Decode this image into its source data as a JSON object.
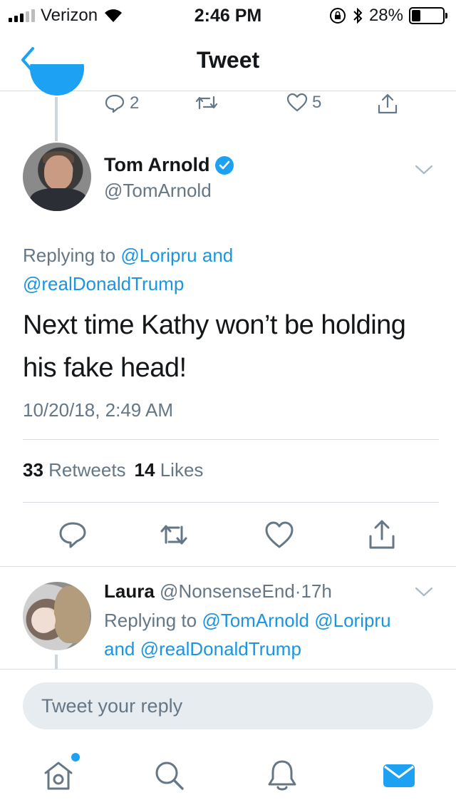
{
  "status_bar": {
    "carrier": "Verizon",
    "time": "2:46 PM",
    "battery": "28%",
    "battery_level": 0.28
  },
  "nav": {
    "title": "Tweet"
  },
  "prev_tweet": {
    "reply_count": "2",
    "like_count": "5"
  },
  "tweet": {
    "author_name": "Tom Arnold",
    "author_handle": "@TomArnold",
    "replying_prefix": "Replying to",
    "replying_user1": "@Loripru",
    "replying_and": "and",
    "replying_user2": "@realDonaldTrump",
    "text": "Next time Kathy won’t be holding his fake head!",
    "timestamp": "10/20/18, 2:49 AM",
    "retweets_count": "33",
    "retweets_label": "Retweets",
    "likes_count": "14",
    "likes_label": "Likes"
  },
  "reply": {
    "name": "Laura",
    "handle": "@NonsenseEnd",
    "dot": "·",
    "time": "17h",
    "replying_prefix": "Replying to",
    "user1": "@TomArnold",
    "user2": "@Loripru",
    "and": "and",
    "user3": "@realDonaldTrump"
  },
  "compose": {
    "placeholder": "Tweet your reply"
  },
  "icons": {
    "accent": "#1da1f2",
    "muted": "#657786"
  }
}
